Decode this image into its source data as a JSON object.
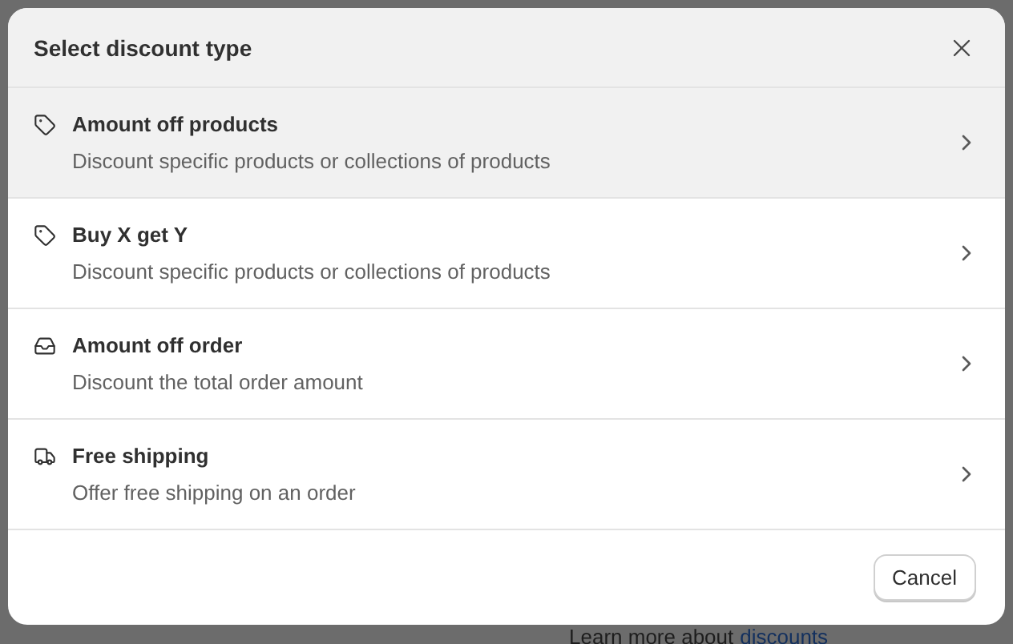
{
  "background": {
    "footer_text": "Learn more about",
    "footer_link": "discounts"
  },
  "dialog": {
    "title": "Select discount type",
    "options": [
      {
        "kind": "products",
        "title": "Amount off products",
        "description": "Discount specific products or collections of products",
        "highlighted": true
      },
      {
        "kind": "bundle",
        "title": "Buy X get Y",
        "description": "Discount specific products or collections of products",
        "highlighted": false
      },
      {
        "kind": "order",
        "title": "Amount off order",
        "description": "Discount the total order amount",
        "highlighted": false
      },
      {
        "kind": "shipping",
        "title": "Free shipping",
        "description": "Offer free shipping on an order",
        "highlighted": false
      }
    ],
    "cancel_button": "Cancel"
  }
}
